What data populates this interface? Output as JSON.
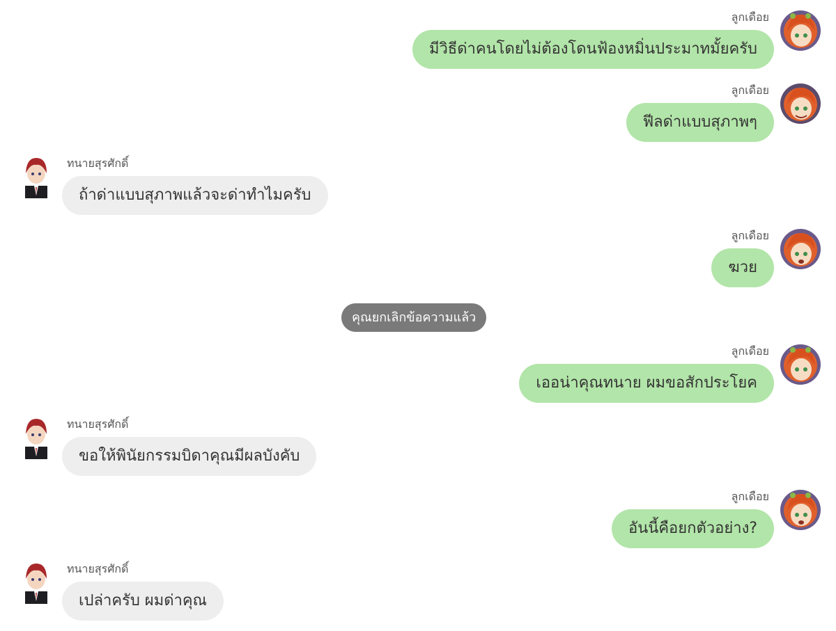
{
  "chat": {
    "self_name": "ลูกเดือย",
    "other_name": "ทนายสุรศักดิ์",
    "colors": {
      "self_bubble": "#b2e5a9",
      "other_bubble": "#eeeeee",
      "system_pill": "#7a7a7a"
    },
    "messages": [
      {
        "sender": "self",
        "name": "ลูกเดือย",
        "text": "มีวิธีด่าคนโดยไม่ต้องโดนฟ้องหมิ่นประมาทมั้ยครับ"
      },
      {
        "sender": "self",
        "name": "ลูกเดือย",
        "text": "ฟีลด่าแบบสุภาพๆ"
      },
      {
        "sender": "other",
        "name": "ทนายสุรศักดิ์",
        "text": "ถ้าด่าแบบสุภาพแล้วจะด่าทำไมครับ"
      },
      {
        "sender": "self",
        "name": "ลูกเดือย",
        "text": "ฆวย"
      },
      {
        "sender": "system",
        "text": "คุณยกเลิกข้อความแล้ว"
      },
      {
        "sender": "self",
        "name": "ลูกเดือย",
        "text": "เออน่าคุณทนาย ผมขอสักประโยค"
      },
      {
        "sender": "other",
        "name": "ทนายสุรศักดิ์",
        "text": "ขอให้พินัยกรรมบิดาคุณมีผลบังคับ"
      },
      {
        "sender": "self",
        "name": "ลูกเดือย",
        "text": "อันนี้คือยกตัวอย่าง?"
      },
      {
        "sender": "other",
        "name": "ทนายสุรศักดิ์",
        "text": "เปล่าครับ ผมด่าคุณ"
      }
    ]
  }
}
